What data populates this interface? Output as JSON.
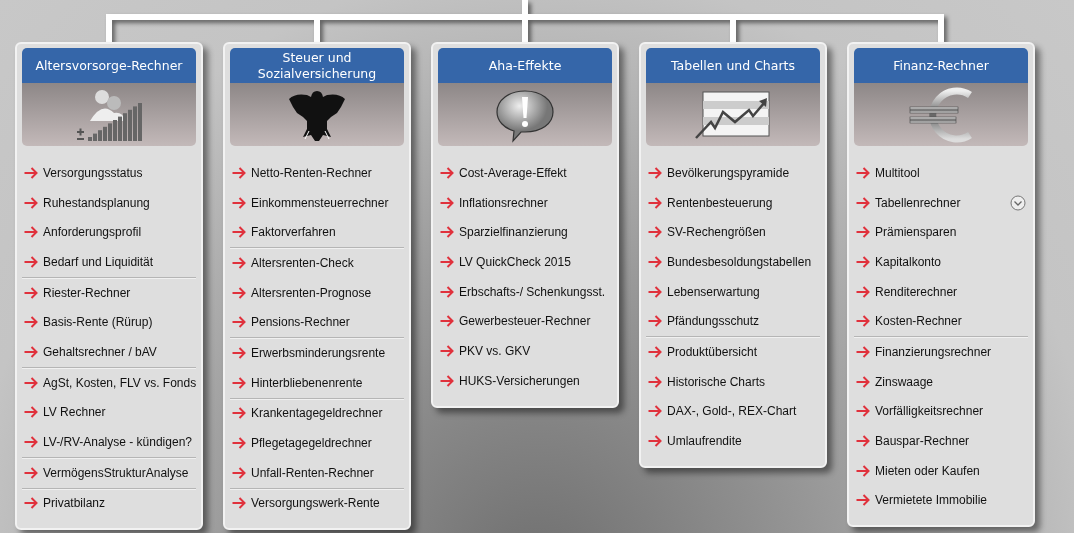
{
  "cards": [
    {
      "title": "Altersvorsorge-Rechner",
      "groups": [
        [
          {
            "label": "Versorgungsstatus"
          },
          {
            "label": "Ruhestandsplanung"
          },
          {
            "label": "Anforderungsprofil"
          },
          {
            "label": "Bedarf und Liquidität"
          }
        ],
        [
          {
            "label": "Riester-Rechner"
          },
          {
            "label": "Basis-Rente (Rürup)"
          },
          {
            "label": "Gehaltsrechner / bAV"
          }
        ],
        [
          {
            "label": "AgSt, Kosten, FLV vs. Fonds"
          },
          {
            "label": "LV Rechner"
          },
          {
            "label": "LV-/RV-Analyse - kündigen?"
          }
        ],
        [
          {
            "label": "VermögensStrukturAnalyse"
          }
        ],
        [
          {
            "label": "Privatbilanz"
          }
        ]
      ]
    },
    {
      "title": "Steuer und Sozialversicherung",
      "groups": [
        [
          {
            "label": "Netto-Renten-Rechner"
          },
          {
            "label": "Einkommensteuerrechner"
          },
          {
            "label": "Faktorverfahren"
          }
        ],
        [
          {
            "label": "Altersrenten-Check"
          },
          {
            "label": "Altersrenten-Prognose"
          },
          {
            "label": "Pensions-Rechner"
          }
        ],
        [
          {
            "label": "Erwerbsminderungsrente"
          },
          {
            "label": "Hinterbliebenenrente"
          }
        ],
        [
          {
            "label": "Krankentagegeldrechner"
          },
          {
            "label": "Pflegetagegeldrechner"
          },
          {
            "label": "Unfall-Renten-Rechner"
          }
        ],
        [
          {
            "label": "Versorgungswerk-Rente"
          }
        ]
      ]
    },
    {
      "title": "Aha-Effekte",
      "groups": [
        [
          {
            "label": "Cost-Average-Effekt"
          },
          {
            "label": "Inflationsrechner"
          },
          {
            "label": "Sparzielfinanzierung"
          },
          {
            "label": "LV QuickCheck 2015"
          },
          {
            "label": "Erbschafts-/ Schenkungsst."
          },
          {
            "label": "Gewerbesteuer-Rechner"
          },
          {
            "label": "PKV vs. GKV"
          },
          {
            "label": "HUKS-Versicherungen"
          }
        ]
      ]
    },
    {
      "title": "Tabellen und Charts",
      "groups": [
        [
          {
            "label": "Bevölkerungspyramide"
          },
          {
            "label": "Rentenbesteuerung"
          },
          {
            "label": "SV-Rechengrößen"
          },
          {
            "label": "Bundesbesoldungstabellen"
          },
          {
            "label": "Lebenserwartung"
          },
          {
            "label": "Pfändungsschutz"
          }
        ],
        [
          {
            "label": "Produktübersicht"
          },
          {
            "label": "Historische Charts"
          },
          {
            "label": "DAX-, Gold-, REX-Chart"
          },
          {
            "label": "Umlaufrendite"
          }
        ]
      ]
    },
    {
      "title": "Finanz-Rechner",
      "groups": [
        [
          {
            "label": "Multitool",
            "expandable": false
          },
          {
            "label": "Tabellenrechner",
            "expandable": true
          },
          {
            "label": "Prämiensparen",
            "expandable": false
          },
          {
            "label": "Kapitalkonto",
            "expandable": false
          },
          {
            "label": "Renditerechner",
            "expandable": false
          },
          {
            "label": "Kosten-Rechner",
            "expandable": false
          }
        ],
        [
          {
            "label": "Finanzierungsrechner",
            "expandable": false
          },
          {
            "label": "Zinswaage",
            "expandable": false
          },
          {
            "label": "Vorfälligkeitsrechner",
            "expandable": false
          },
          {
            "label": "Bauspar-Rechner",
            "expandable": false
          },
          {
            "label": "Mieten oder Kaufen",
            "expandable": false
          },
          {
            "label": "Vermietete Immobilie",
            "expandable": false
          }
        ]
      ]
    }
  ]
}
